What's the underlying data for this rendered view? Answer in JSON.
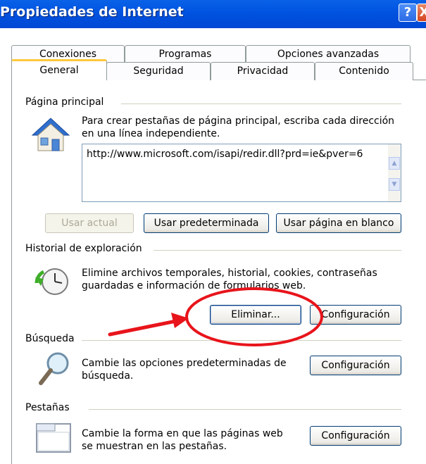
{
  "window": {
    "title": "Propiedades de Internet",
    "help_glyph": "?",
    "close_glyph": "X"
  },
  "tabs": {
    "row1": [
      "Conexiones",
      "Programas",
      "Opciones avanzadas"
    ],
    "row2": [
      "General",
      "Seguridad",
      "Privacidad",
      "Contenido"
    ],
    "active": "General"
  },
  "home": {
    "label": "Página principal",
    "desc_line1": "Para crear pestañas de página principal, escriba cada dirección",
    "desc_line2": "en una línea independiente.",
    "url_value": "http://www.microsoft.com/isapi/redir.dll?prd=ie&pver=6",
    "btn_current": "Usar actual",
    "btn_default": "Usar predeterminada",
    "btn_blank": "Usar página en blanco"
  },
  "history": {
    "label": "Historial de exploración",
    "desc_line1": "Elimine archivos temporales, historial, cookies, contraseñas",
    "desc_line2": "guardadas e información de formularios web.",
    "btn_delete": "Eliminar...",
    "btn_settings": "Configuración"
  },
  "search": {
    "label": "Búsqueda",
    "desc_line1": "Cambie las opciones predeterminadas de",
    "desc_line2": "búsqueda.",
    "btn_settings": "Configuración"
  },
  "tabs_group": {
    "label": "Pestañas",
    "desc_line1": "Cambie la forma en que las páginas web",
    "desc_line2": "se muestran en las pestañas.",
    "btn_settings": "Configuración"
  },
  "colors": {
    "titlebar": "#0053e0",
    "annotation": "#e8141b",
    "active_tab_accent": "#ffc83c"
  }
}
